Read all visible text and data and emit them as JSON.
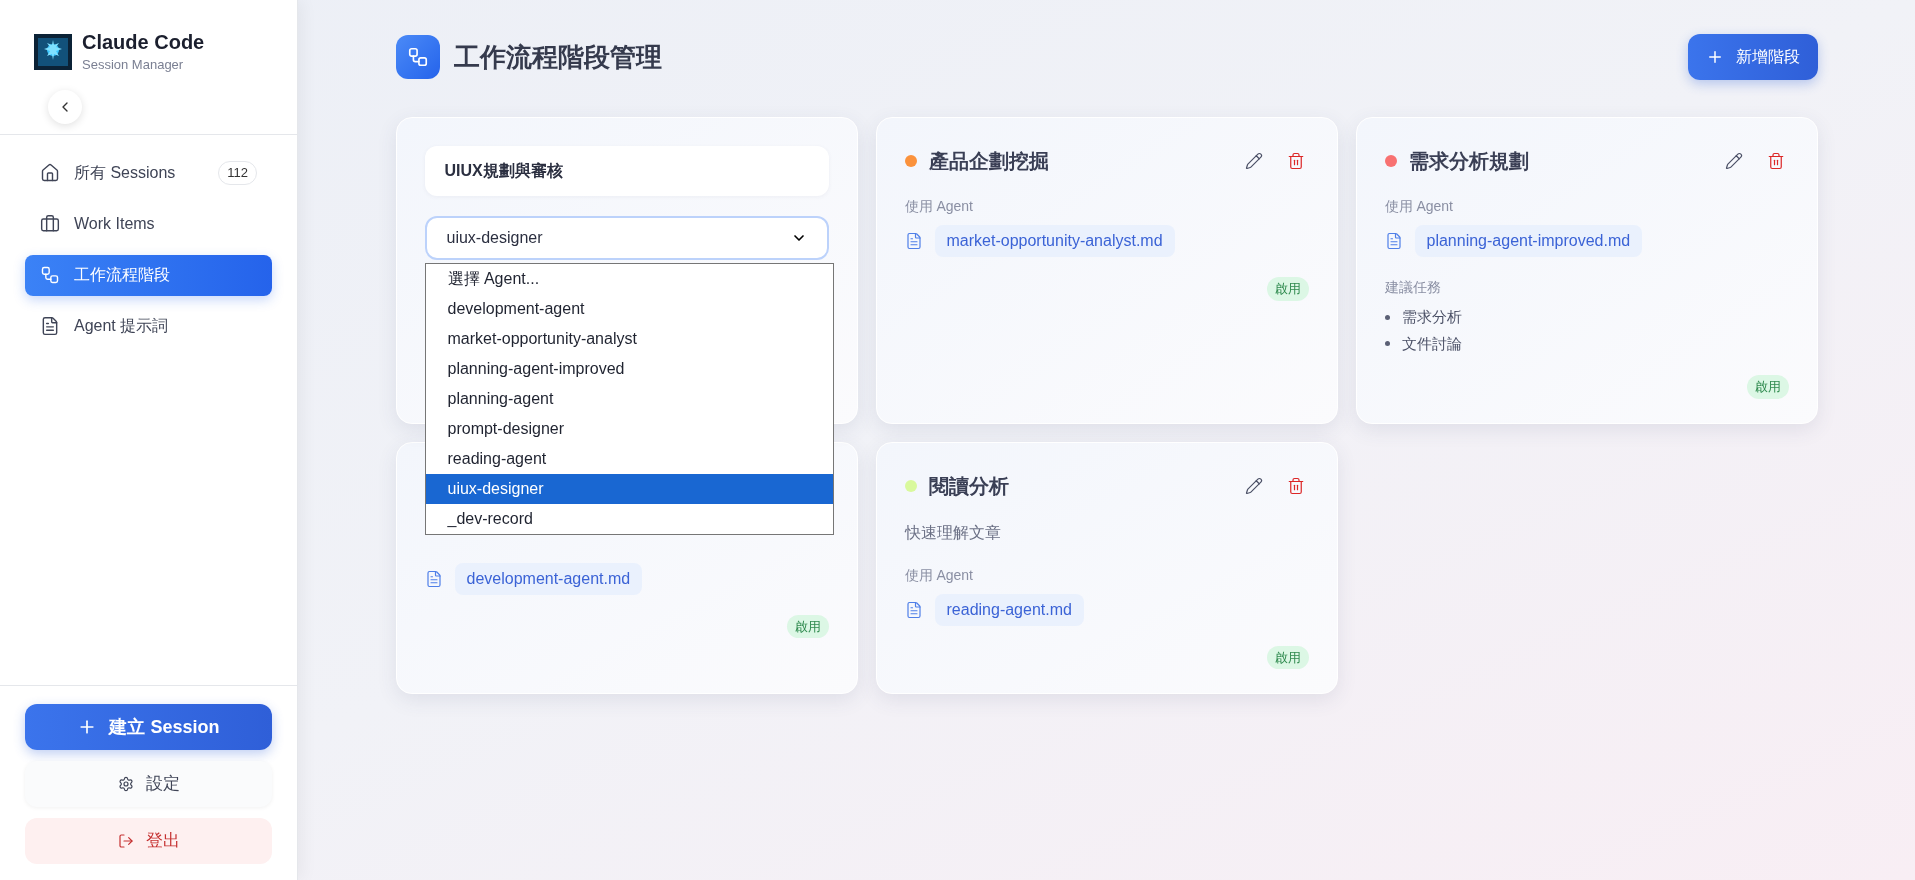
{
  "sidebar": {
    "app_title": "Claude Code",
    "app_subtitle": "Session Manager",
    "nav": [
      {
        "label": "所有 Sessions",
        "badge": "112",
        "selected": false
      },
      {
        "label": "Work Items",
        "selected": false
      },
      {
        "label": "工作流程階段",
        "selected": true
      },
      {
        "label": "Agent 提示詞",
        "selected": false
      }
    ],
    "create_button": "建立 Session",
    "settings_button": "設定",
    "logout_button": "登出"
  },
  "header": {
    "title": "工作流程階段管理",
    "add_button": "新增階段"
  },
  "cards": [
    {
      "kind": "edit",
      "name_value": "UIUX規劃與審核",
      "agent_select": {
        "value": "uiux-designer",
        "expanded": true,
        "options": [
          {
            "label": "選擇 Agent...",
            "selected": false
          },
          {
            "label": "development-agent",
            "selected": false
          },
          {
            "label": "market-opportunity-analyst",
            "selected": false
          },
          {
            "label": "planning-agent-improved",
            "selected": false
          },
          {
            "label": "planning-agent",
            "selected": false
          },
          {
            "label": "prompt-designer",
            "selected": false
          },
          {
            "label": "reading-agent",
            "selected": false
          },
          {
            "label": "uiux-designer",
            "selected": true
          },
          {
            "label": "_dev-record",
            "selected": false
          }
        ]
      }
    },
    {
      "kind": "view",
      "title": "產品企劃挖掘",
      "color": "#fb923c",
      "agent_label": "使用 Agent",
      "agent_file": "market-opportunity-analyst.md",
      "status": "啟用",
      "enabled": true
    },
    {
      "kind": "view",
      "title": "需求分析規劃",
      "color": "#f87171",
      "agent_label": "使用 Agent",
      "agent_file": "planning-agent-improved.md",
      "tasks_label": "建議任務",
      "tasks": [
        "需求分析",
        "文件討論"
      ],
      "status": "啟用",
      "enabled": true
    },
    {
      "kind": "covered",
      "agent_file": "development-agent.md",
      "status": "啟用",
      "enabled": true
    },
    {
      "kind": "view",
      "title": "閱讀分析",
      "color": "#d9f99d",
      "description": "快速理解文章",
      "agent_label": "使用 Agent",
      "agent_file": "reading-agent.md",
      "status": "啟用",
      "enabled": true
    }
  ]
}
